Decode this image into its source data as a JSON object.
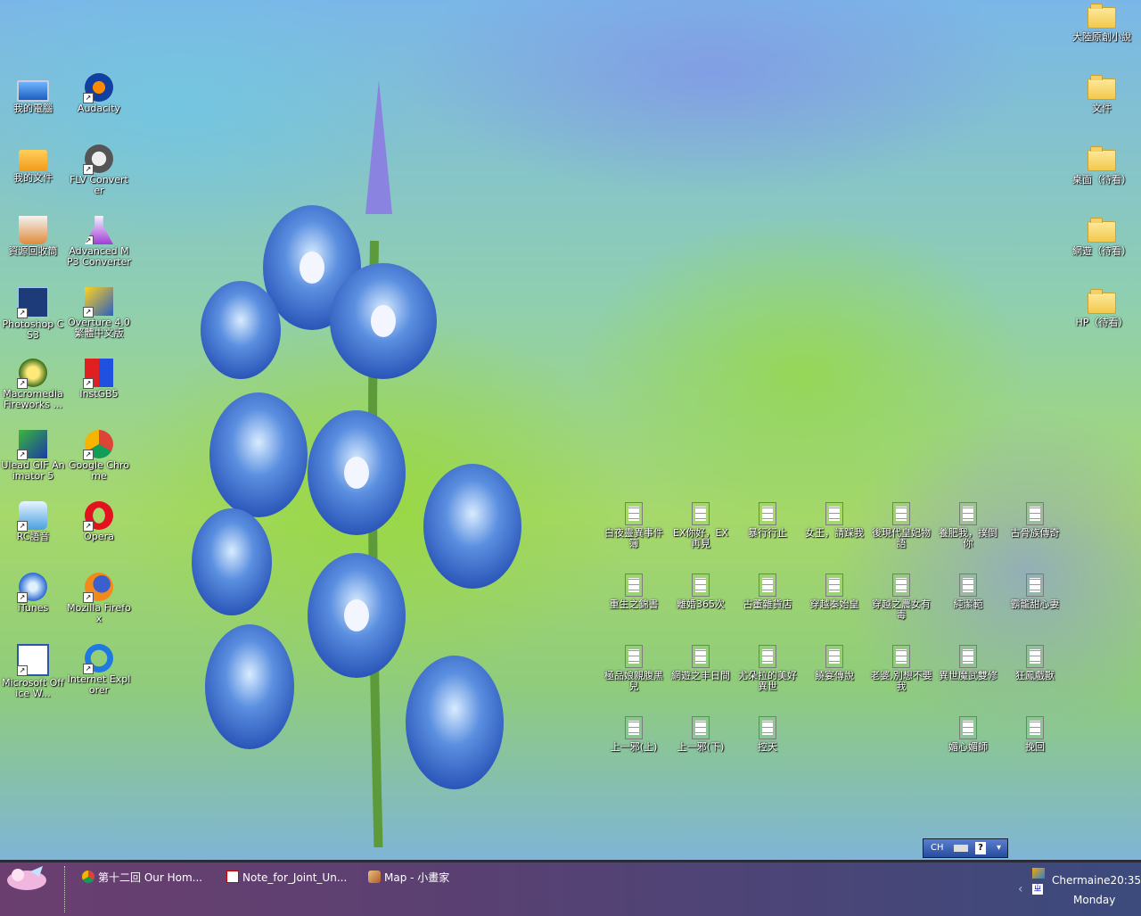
{
  "desktop": {
    "left_icons": [
      {
        "label": "我的電腦",
        "icon": "computer-icon"
      },
      {
        "label": "Audacity",
        "icon": "audacity-icon"
      },
      {
        "label": "我的文件",
        "icon": "my-documents-icon"
      },
      {
        "label": "FLV Converter",
        "icon": "flv-converter-icon"
      },
      {
        "label": "資源回收筒",
        "icon": "recycle-bin-icon"
      },
      {
        "label": "Advanced MP3 Converter",
        "icon": "mp3-converter-icon"
      },
      {
        "label": "Photoshop CS3",
        "icon": "photoshop-icon"
      },
      {
        "label": "Overture 4.0 繁體中文版",
        "icon": "overture-icon"
      },
      {
        "label": "Macromedia Fireworks ...",
        "icon": "fireworks-icon"
      },
      {
        "label": "InstGB5",
        "icon": "instgb5-icon"
      },
      {
        "label": "Ulead GIF Animator 5",
        "icon": "ulead-gif-icon"
      },
      {
        "label": "Google Chrome",
        "icon": "chrome-icon"
      },
      {
        "label": "RC語音",
        "icon": "rc-voice-icon"
      },
      {
        "label": "Opera",
        "icon": "opera-icon"
      },
      {
        "label": "iTunes",
        "icon": "itunes-icon"
      },
      {
        "label": "Mozilla Firefox",
        "icon": "firefox-icon"
      },
      {
        "label": "Microsoft Office W...",
        "icon": "word-icon"
      },
      {
        "label": "Internet Explorer",
        "icon": "ie-icon"
      }
    ],
    "right_folders": [
      {
        "label": "大陸原創小說"
      },
      {
        "label": "文件"
      },
      {
        "label": "桌面（待看）"
      },
      {
        "label": "網遊（待看）"
      },
      {
        "label": "HP（待看）"
      }
    ],
    "text_files": [
      [
        "白夜靈異事件簿",
        "EX你好，EX再見",
        "暴行行止",
        "女王，請踩我",
        "後現代皇妃物語",
        "養肥我，撲倒你",
        "古骨族傳奇"
      ],
      [
        "重生之錦書",
        "離婚365次",
        "古董雜貨店",
        "穿越秦始皇",
        "穿越之農女有毒",
        "純潔範",
        "霸籠甜心妻"
      ],
      [
        "極品娘親腹黑兒",
        "網遊之丰日間",
        "尤朵拉的美好異世",
        "饒宴傳說",
        "老婆,別想不要我",
        "異世魔武雙修",
        "狂鳳戲獸"
      ],
      [
        "上一邪(上)",
        "上一邪(下)",
        "控天",
        "",
        "",
        "媚心媚師",
        "挽回"
      ]
    ]
  },
  "taskbar": {
    "tasks": [
      {
        "label": "第十二回 Our Hom...",
        "icon": "chrome-icon"
      },
      {
        "label": "Note_for_Joint_Un...",
        "icon": "pdf-icon"
      },
      {
        "label": "Map - 小畫家",
        "icon": "paint-icon"
      }
    ],
    "clock": {
      "user": "Chermaine",
      "time": "20:35",
      "day": "Monday"
    }
  },
  "langbar": {
    "lang": "CH"
  },
  "colors": {
    "taskbar_left": "#6a3f6f",
    "taskbar_right": "#3c4a7c",
    "label_text": "#ffffff"
  }
}
